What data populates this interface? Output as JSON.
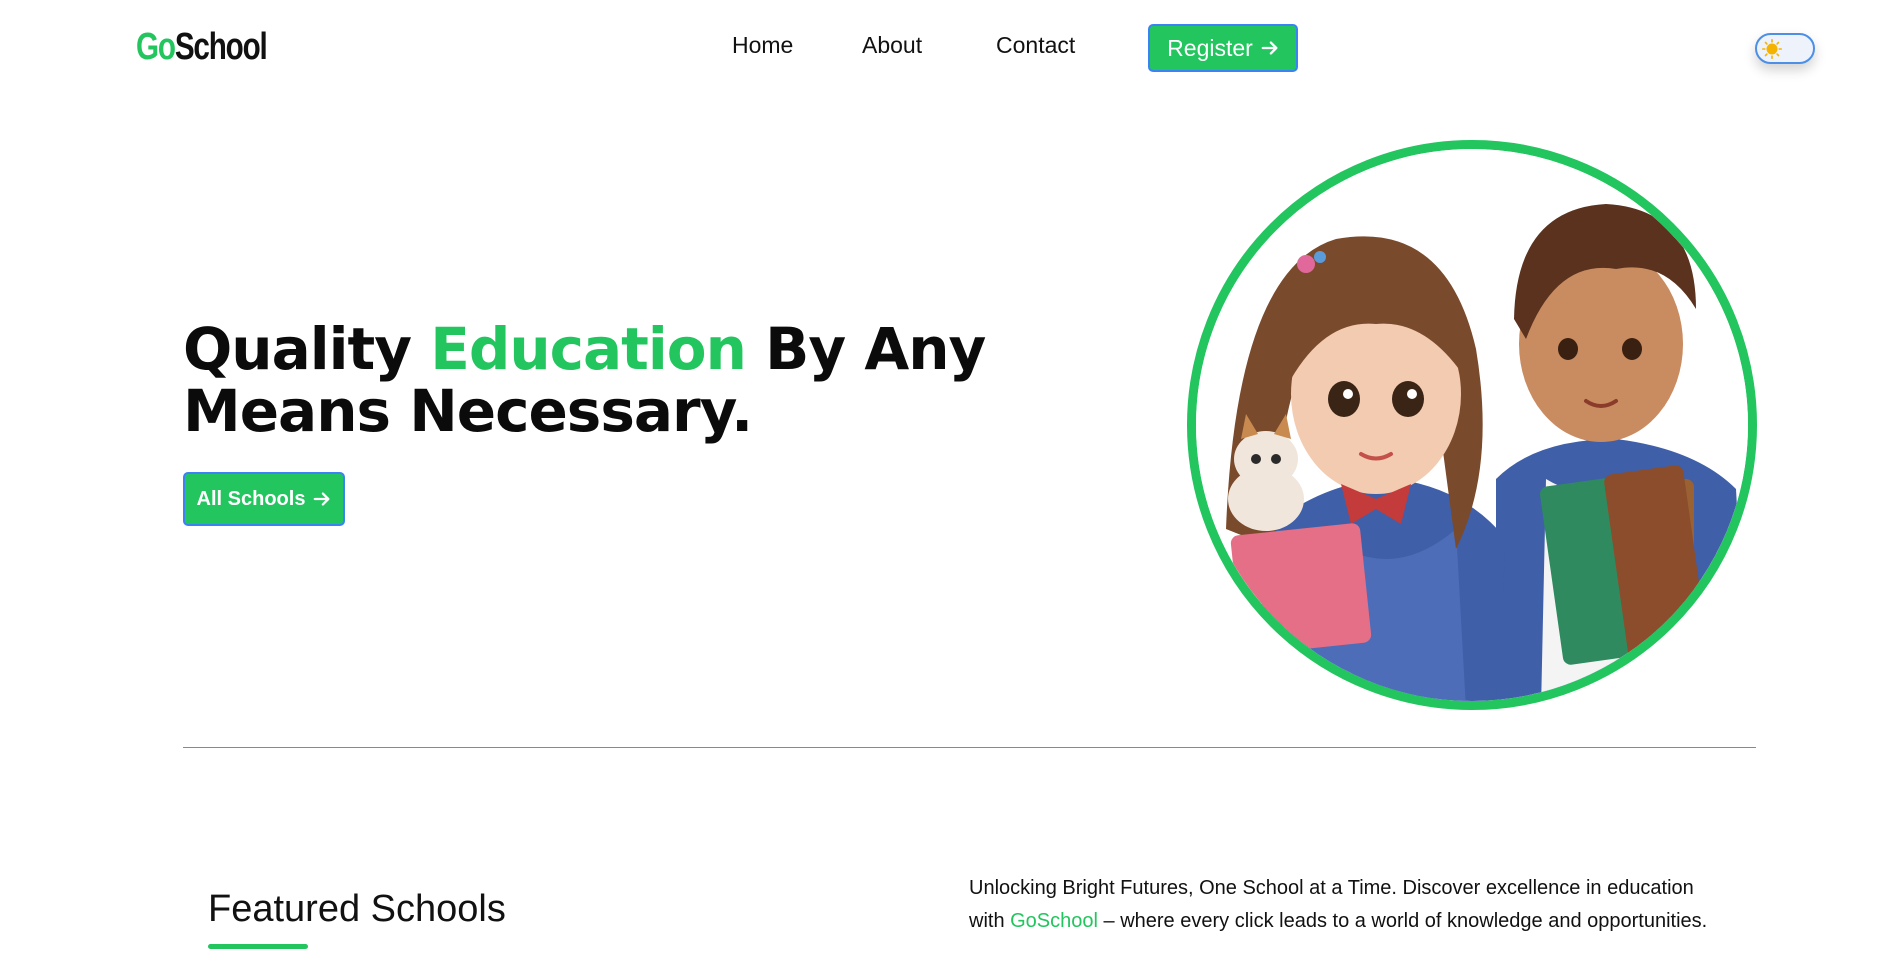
{
  "header": {
    "logo_go": "Go",
    "logo_school": "School",
    "nav": {
      "home": "Home",
      "about": "About",
      "contact": "Contact"
    },
    "register_label": "Register",
    "theme_toggle_icon": "sun-icon"
  },
  "hero": {
    "title_part1": "Quality ",
    "title_accent": "Education",
    "title_part2": " By Any Means Necessary.",
    "cta_label": "All Schools",
    "image_alt_icon": "students-illustration"
  },
  "featured": {
    "title": "Featured Schools",
    "tagline_part1": "Unlocking Bright Futures, One School at a Time. Discover excellence in education with ",
    "tagline_brand": "GoSchool",
    "tagline_part2": " – where every click leads to a world of knowledge and opportunities."
  },
  "colors": {
    "accent": "#22c55e",
    "focus_border": "#3b82f6",
    "text": "#111111"
  }
}
